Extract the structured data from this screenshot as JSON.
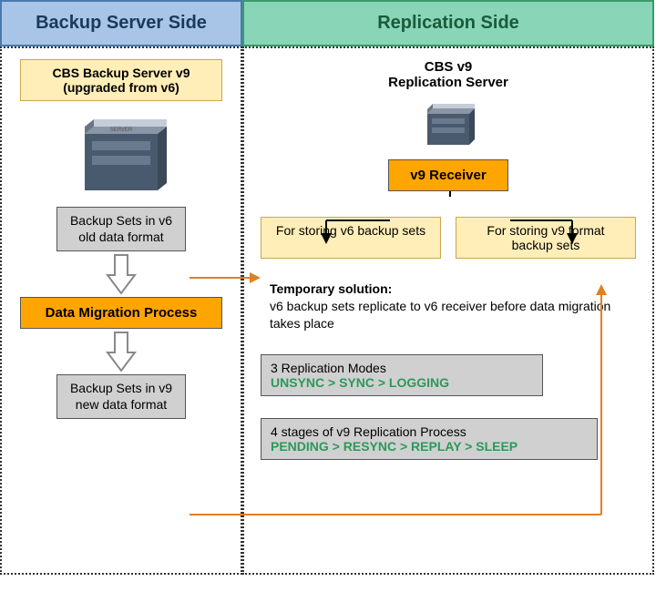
{
  "headers": {
    "left": "Backup Server Side",
    "right": "Replication Side"
  },
  "left_col": {
    "cbs_title_line1": "CBS Backup Server v9",
    "cbs_title_line2": "(upgraded from v6)",
    "backup_v6": "Backup Sets in v6 old data format",
    "migration": "Data Migration Process",
    "backup_v9": "Backup Sets in v9 new data format"
  },
  "right_col": {
    "cbs_line1": "CBS v9",
    "cbs_line2": "Replication Server",
    "receiver": "v9 Receiver",
    "store_v6": "For storing v6 backup sets",
    "store_v9": "For storing v9 format backup sets",
    "temp_title": "Temporary solution:",
    "temp_body": "v6 backup sets replicate to v6 receiver before data migration takes place",
    "modes_title": "3 Replication Modes",
    "modes_list": "UNSYNC > SYNC > LOGGING",
    "stages_title": "4 stages of v9 Replication Process",
    "stages_list": "PENDING > RESYNC > REPLAY > SLEEP"
  },
  "colors": {
    "header_left_bg": "#a8c5e8",
    "header_right_bg": "#88d5b8",
    "orange": "#ffa500",
    "yellow": "#ffeeb8",
    "gray": "#d0d0d0",
    "arrow_orange": "#e08020",
    "green_text": "#2a9a5a"
  },
  "icons": {
    "server_large": "server-icon",
    "server_small": "server-icon"
  }
}
